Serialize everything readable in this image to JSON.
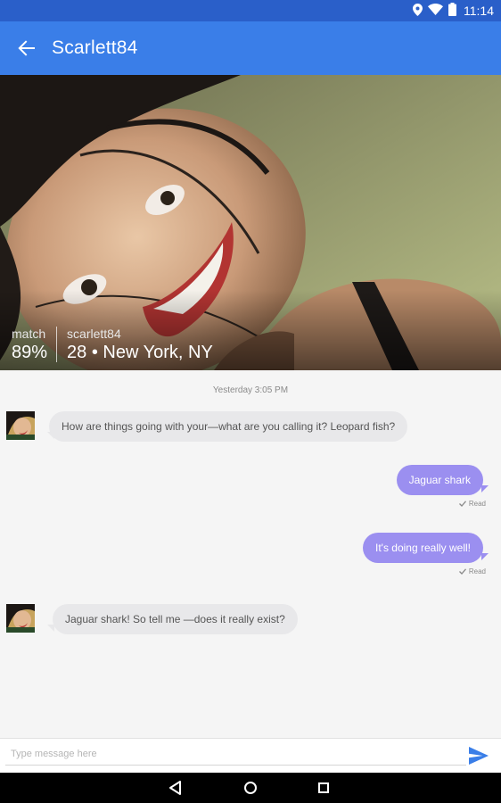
{
  "status_bar": {
    "time": "11:14",
    "icons": [
      "location-icon",
      "wifi-icon",
      "battery-icon"
    ]
  },
  "app_bar": {
    "title": "Scarlett84",
    "back_icon": "arrow-back-icon",
    "background": "#3a7ee8"
  },
  "profile": {
    "match_label": "match",
    "match_value": "89%",
    "username": "scarlett84",
    "details": "28 • New York, NY"
  },
  "chat": {
    "timestamp": "Yesterday 3:05 PM",
    "messages": [
      {
        "direction": "incoming",
        "text": "How are things going with your—what are you calling it? Leopard fish?"
      },
      {
        "direction": "outgoing",
        "text": "Jaguar shark",
        "status": "Read"
      },
      {
        "direction": "outgoing",
        "text": "It's doing really well!",
        "status": "Read"
      },
      {
        "direction": "incoming",
        "text": "Jaguar shark! So tell me —does it really exist?"
      }
    ],
    "outgoing_color": "#9b8ff0",
    "incoming_color": "#e8e8ea"
  },
  "composer": {
    "placeholder": "Type message here",
    "value": "",
    "send_icon": "send-icon",
    "send_color": "#3a7ee8"
  },
  "nav_bar": {
    "icons": [
      "back-triangle-icon",
      "home-circle-icon",
      "recents-square-icon"
    ]
  }
}
